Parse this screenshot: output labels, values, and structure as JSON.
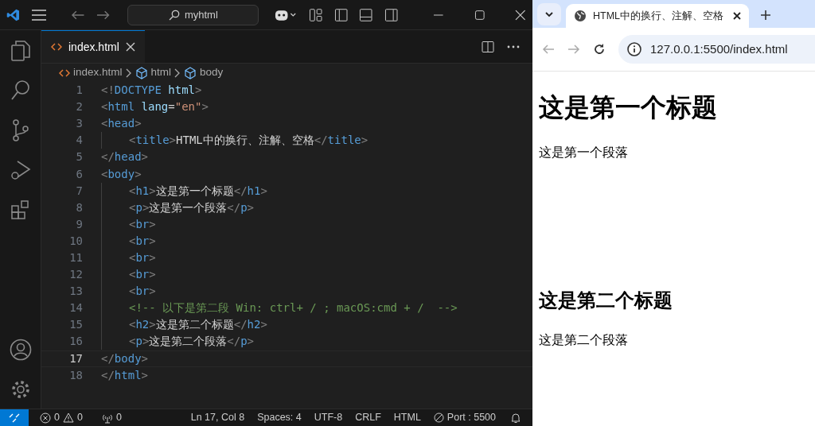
{
  "editor": {
    "search": "myhtml",
    "tabs": [
      {
        "label": "index.html",
        "selected": true
      }
    ],
    "breadcrumbs": [
      "index.html",
      "html",
      "body"
    ],
    "lines": [
      {
        "number": "1",
        "current": false,
        "indented": false,
        "tokens": [
          {
            "kind": "bracket",
            "text": "<!"
          },
          {
            "kind": "tag",
            "text": "DOCTYPE"
          },
          {
            "kind": "attr",
            "text": " html"
          },
          {
            "kind": "bracket",
            "text": ">"
          }
        ]
      },
      {
        "number": "2",
        "current": false,
        "indented": false,
        "tokens": [
          {
            "kind": "bracket",
            "text": "<"
          },
          {
            "kind": "tag",
            "text": "html"
          },
          {
            "kind": "attr",
            "text": " lang"
          },
          {
            "kind": "text",
            "text": "="
          },
          {
            "kind": "string",
            "text": "\"en\""
          },
          {
            "kind": "bracket",
            "text": ">"
          }
        ]
      },
      {
        "number": "3",
        "current": false,
        "indented": false,
        "tokens": [
          {
            "kind": "bracket",
            "text": "<"
          },
          {
            "kind": "tag",
            "text": "head"
          },
          {
            "kind": "bracket",
            "text": ">"
          }
        ]
      },
      {
        "number": "4",
        "current": false,
        "indented": true,
        "tokens": [
          {
            "kind": "bracket",
            "text": "<"
          },
          {
            "kind": "tag",
            "text": "title"
          },
          {
            "kind": "bracket",
            "text": ">"
          },
          {
            "kind": "text",
            "text": "HTML中的换行、注解、空格"
          },
          {
            "kind": "bracket",
            "text": "</"
          },
          {
            "kind": "tag",
            "text": "title"
          },
          {
            "kind": "bracket",
            "text": ">"
          }
        ]
      },
      {
        "number": "5",
        "current": false,
        "indented": false,
        "tokens": [
          {
            "kind": "bracket",
            "text": "</"
          },
          {
            "kind": "tag",
            "text": "head"
          },
          {
            "kind": "bracket",
            "text": ">"
          }
        ]
      },
      {
        "number": "6",
        "current": false,
        "indented": false,
        "tokens": [
          {
            "kind": "bracket",
            "text": "<"
          },
          {
            "kind": "tag",
            "text": "body"
          },
          {
            "kind": "bracket",
            "text": ">"
          }
        ]
      },
      {
        "number": "7",
        "current": false,
        "indented": true,
        "tokens": [
          {
            "kind": "bracket",
            "text": "<"
          },
          {
            "kind": "tag",
            "text": "h1"
          },
          {
            "kind": "bracket",
            "text": ">"
          },
          {
            "kind": "text",
            "text": "这是第一个标题"
          },
          {
            "kind": "bracket",
            "text": "</"
          },
          {
            "kind": "tag",
            "text": "h1"
          },
          {
            "kind": "bracket",
            "text": ">"
          }
        ]
      },
      {
        "number": "8",
        "current": false,
        "indented": true,
        "tokens": [
          {
            "kind": "bracket",
            "text": "<"
          },
          {
            "kind": "tag",
            "text": "p"
          },
          {
            "kind": "bracket",
            "text": ">"
          },
          {
            "kind": "text",
            "text": "这是第一个段落"
          },
          {
            "kind": "bracket",
            "text": "</"
          },
          {
            "kind": "tag",
            "text": "p"
          },
          {
            "kind": "bracket",
            "text": ">"
          }
        ]
      },
      {
        "number": "9",
        "current": false,
        "indented": true,
        "tokens": [
          {
            "kind": "bracket",
            "text": "<"
          },
          {
            "kind": "tag",
            "text": "br"
          },
          {
            "kind": "bracket",
            "text": ">"
          }
        ]
      },
      {
        "number": "10",
        "current": false,
        "indented": true,
        "tokens": [
          {
            "kind": "bracket",
            "text": "<"
          },
          {
            "kind": "tag",
            "text": "br"
          },
          {
            "kind": "bracket",
            "text": ">"
          }
        ]
      },
      {
        "number": "11",
        "current": false,
        "indented": true,
        "tokens": [
          {
            "kind": "bracket",
            "text": "<"
          },
          {
            "kind": "tag",
            "text": "br"
          },
          {
            "kind": "bracket",
            "text": ">"
          }
        ]
      },
      {
        "number": "12",
        "current": false,
        "indented": true,
        "tokens": [
          {
            "kind": "bracket",
            "text": "<"
          },
          {
            "kind": "tag",
            "text": "br"
          },
          {
            "kind": "bracket",
            "text": ">"
          }
        ]
      },
      {
        "number": "13",
        "current": false,
        "indented": true,
        "tokens": [
          {
            "kind": "bracket",
            "text": "<"
          },
          {
            "kind": "tag",
            "text": "br"
          },
          {
            "kind": "bracket",
            "text": ">"
          }
        ]
      },
      {
        "number": "14",
        "current": false,
        "indented": true,
        "tokens": [
          {
            "kind": "comment",
            "text": "<!-- 以下是第二段 Win: ctrl+ / ; macOS:cmd + /  -->"
          }
        ]
      },
      {
        "number": "15",
        "current": false,
        "indented": true,
        "tokens": [
          {
            "kind": "bracket",
            "text": "<"
          },
          {
            "kind": "tag",
            "text": "h2"
          },
          {
            "kind": "bracket",
            "text": ">"
          },
          {
            "kind": "text",
            "text": "这是第二个标题"
          },
          {
            "kind": "bracket",
            "text": "</"
          },
          {
            "kind": "tag",
            "text": "h2"
          },
          {
            "kind": "bracket",
            "text": ">"
          }
        ]
      },
      {
        "number": "16",
        "current": false,
        "indented": true,
        "tokens": [
          {
            "kind": "bracket",
            "text": "<"
          },
          {
            "kind": "tag",
            "text": "p"
          },
          {
            "kind": "bracket",
            "text": ">"
          },
          {
            "kind": "text",
            "text": "这是第二个段落"
          },
          {
            "kind": "bracket",
            "text": "</"
          },
          {
            "kind": "tag",
            "text": "p"
          },
          {
            "kind": "bracket",
            "text": ">"
          }
        ]
      },
      {
        "number": "17",
        "current": true,
        "indented": false,
        "tokens": [
          {
            "kind": "bracket",
            "text": "</"
          },
          {
            "kind": "tag",
            "text": "body"
          },
          {
            "kind": "bracket",
            "text": ">"
          }
        ]
      },
      {
        "number": "18",
        "current": false,
        "indented": false,
        "tokens": [
          {
            "kind": "bracket",
            "text": "</"
          },
          {
            "kind": "tag",
            "text": "html"
          },
          {
            "kind": "bracket",
            "text": ">"
          }
        ]
      }
    ],
    "status_bar": {
      "errors": "0",
      "warnings": "0",
      "ports": "0",
      "items": [
        "Ln 17, Col 8",
        "Spaces: 4",
        "UTF-8",
        "CRLF",
        "HTML"
      ],
      "live_server": "Port : 5500"
    }
  },
  "browser": {
    "tabs": [
      {
        "title": "HTML中的换行、注解、空格",
        "selected": true
      }
    ],
    "url": "127.0.0.1:5500/index.html",
    "content": [
      {
        "kind": "h1",
        "text": "这是第一个标题"
      },
      {
        "kind": "p",
        "text": "这是第一个段落"
      },
      {
        "kind": "br"
      },
      {
        "kind": "br"
      },
      {
        "kind": "br"
      },
      {
        "kind": "br"
      },
      {
        "kind": "br"
      },
      {
        "kind": "h2",
        "text": "这是第二个标题"
      },
      {
        "kind": "p",
        "text": "这是第二个段落"
      }
    ]
  }
}
